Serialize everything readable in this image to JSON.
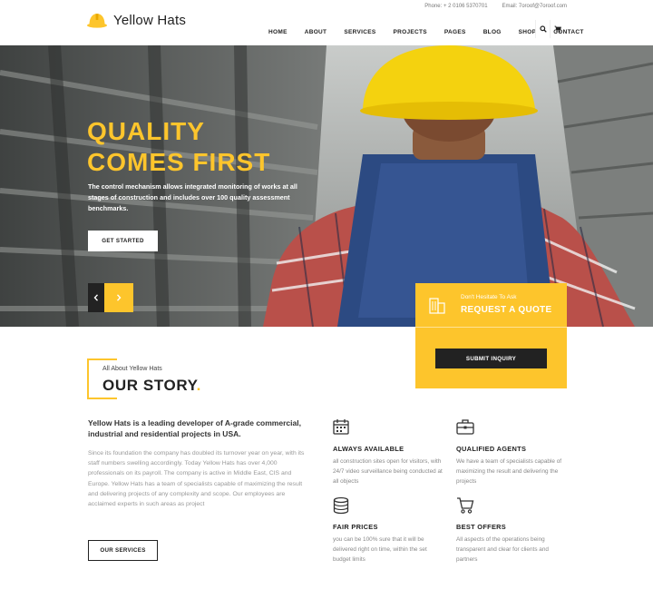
{
  "header": {
    "logo_text": "Yellow Hats",
    "phone": "Phone: + 2 0106 5370701",
    "email": "Email: 7oroof@7oroof.com",
    "nav": [
      "HOME",
      "ABOUT",
      "SERVICES",
      "PROJECTS",
      "PAGES",
      "BLOG",
      "SHOP",
      "CONTACT"
    ]
  },
  "hero": {
    "title_line1": "QUALITY",
    "title_line2": "COMES FIRST",
    "description": "The control mechanism allows integrated monitoring of works at all stages of construction and includes over 100 quality assessment benchmarks.",
    "cta": "GET STARTED"
  },
  "quote": {
    "subtitle": "Don't Hesitate To Ask",
    "title": "REQUEST A QUOTE",
    "button": "SUBMIT INQUIRY"
  },
  "story": {
    "eyebrow": "All About Yellow Hats",
    "title": "OUR STORY",
    "title_dot": ".",
    "lead": "Yellow Hats is a leading developer of A-grade commercial, industrial and residential projects in USA.",
    "body": "Since its foundation the company has doubled its turnover year on year, with its staff numbers swelling accordingly. Today Yellow Hats has over 4,000 professionals on its payroll. The company is active in Middle East, CIS and Europe. Yellow Hats has a team of specialists capable of maximizing the result and delivering projects of any complexity and scope. Our employees are acclaimed experts in such areas as project",
    "button": "OUR SERVICES"
  },
  "features": [
    {
      "title": "ALWAYS AVAILABLE",
      "text": "all construction sites open for visitors, with 24/7 video surveillance being conducted at all objects",
      "icon": "calendar-icon"
    },
    {
      "title": "QUALIFIED AGENTS",
      "text": "We have a team of specialists capable of maximizing the result and delivering the projects",
      "icon": "briefcase-icon"
    },
    {
      "title": "FAIR PRICES",
      "text": "you can be 100% sure that it will be delivered right on time, within the set budget limits",
      "icon": "coins-icon"
    },
    {
      "title": "BEST OFFERS",
      "text": "All aspects of the operations being transparent and clear for clients and partners",
      "icon": "cart-icon"
    }
  ],
  "colors": {
    "accent": "#fdc52c",
    "dark": "#222222"
  }
}
